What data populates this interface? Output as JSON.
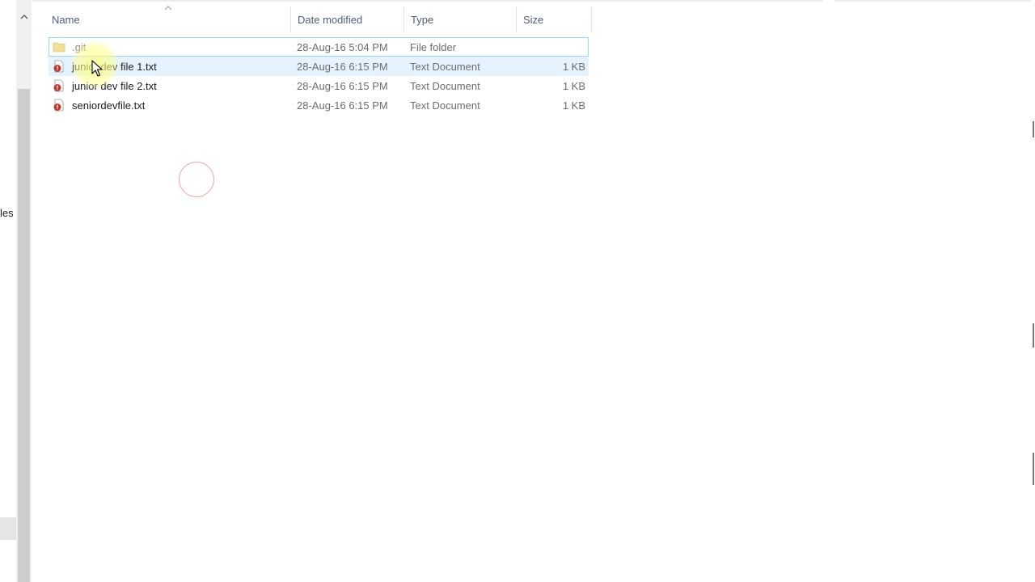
{
  "nav": {
    "clipped_label": "les"
  },
  "columns": {
    "name": "Name",
    "date": "Date modified",
    "type": "Type",
    "size": "Size"
  },
  "files": [
    {
      "name": ".git",
      "date": "28-Aug-16 5:04 PM",
      "type": "File folder",
      "size": "",
      "icon": "folder-icon"
    },
    {
      "name": "junior dev file 1.txt",
      "date": "28-Aug-16 6:15 PM",
      "type": "Text Document",
      "size": "1 KB",
      "icon": "conflict-text-file-icon"
    },
    {
      "name": "junior dev file 2.txt",
      "date": "28-Aug-16 6:15 PM",
      "type": "Text Document",
      "size": "1 KB",
      "icon": "conflict-text-file-icon"
    },
    {
      "name": "seniordevfile.txt",
      "date": "28-Aug-16 6:15 PM",
      "type": "Text Document",
      "size": "1 KB",
      "icon": "conflict-text-file-icon"
    }
  ],
  "colors": {
    "header_text": "#4c607a",
    "selection_border": "#99d1ff",
    "hover_background": "#e5f3ff",
    "overlay_badge": "#c0392b",
    "folder": "#f8d775"
  }
}
